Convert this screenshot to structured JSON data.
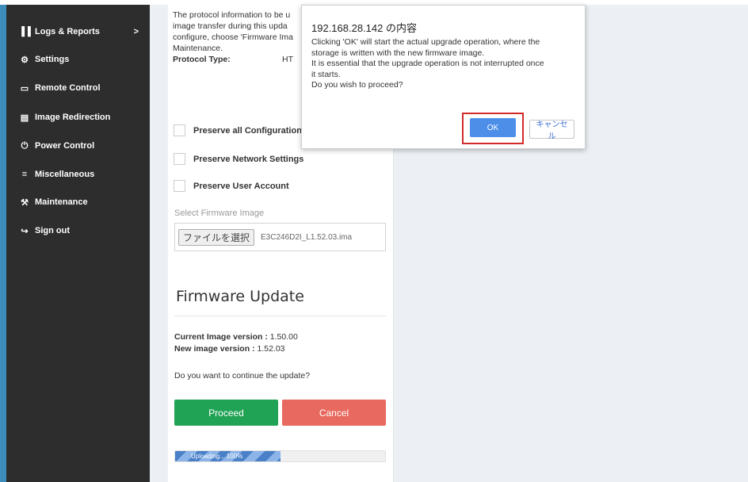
{
  "sidebar": {
    "items": [
      {
        "label": "Logs & Reports",
        "icon": "bar-chart-icon",
        "glyph": "▐▐",
        "chevron": ">"
      },
      {
        "label": "Settings",
        "icon": "gear-icon",
        "glyph": "⚙"
      },
      {
        "label": "Remote Control",
        "icon": "monitor-icon",
        "glyph": "▭"
      },
      {
        "label": "Image Redirection",
        "icon": "drive-icon",
        "glyph": "▤"
      },
      {
        "label": "Power Control",
        "icon": "power-icon",
        "glyph": "⏻"
      },
      {
        "label": "Miscellaneous",
        "icon": "menu-icon",
        "glyph": "≡"
      },
      {
        "label": "Maintenance",
        "icon": "wrench-icon",
        "glyph": "⚒"
      },
      {
        "label": "Sign out",
        "icon": "sign-out-icon",
        "glyph": "↪"
      }
    ]
  },
  "content": {
    "desc_lines": [
      "The protocol information to be u",
      "image transfer during this upda",
      "configure, choose 'Firmware Ima",
      "Maintenance."
    ],
    "protocol_label": "Protocol Type:",
    "protocol_value": "HT",
    "checks": [
      "Preserve all Configuration",
      "Preserve Network Settings",
      "Preserve User Account"
    ],
    "select_label": "Select Firmware Image",
    "file_button": "ファイルを選択",
    "file_name": "E3C246D2I_L1.52.03.ima",
    "section_title": "Firmware Update",
    "current_label": "Current Image version :",
    "current_value": "1.50.00",
    "new_label": "New image version :",
    "new_value": "1.52.03",
    "question": "Do you want to continue the update?",
    "proceed": "Proceed",
    "cancel": "Cancel",
    "progress_text": "Uploading... 100%",
    "progress_fraction": 0.5
  },
  "dialog": {
    "title": "192.168.28.142 の内容",
    "message": [
      "Clicking 'OK' will start the actual upgrade operation, where the",
      "storage is written with the new firmware image.",
      "It is essential that the upgrade operation is not interrupted once",
      "it starts.",
      "Do you wish to proceed?"
    ],
    "ok": "OK",
    "cancel": "キャンセル"
  },
  "colors": {
    "sidebar_bg": "#2d2d2d",
    "proceed": "#21a355",
    "cancel": "#e8695f",
    "ok": "#4d8ee8",
    "highlight": "#d22a2a"
  }
}
